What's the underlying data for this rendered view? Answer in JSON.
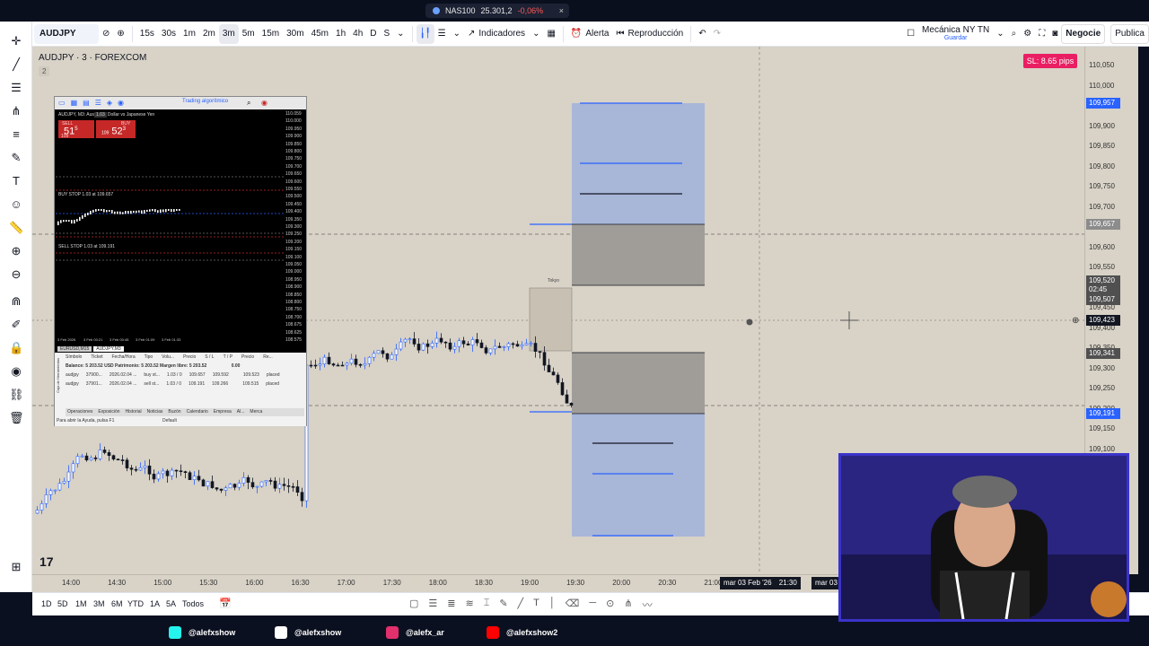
{
  "topstrip": {
    "ticker": "NAS100",
    "price": "25.301,2",
    "change": "-0,06%",
    "close": "×"
  },
  "toolbar": {
    "symbol": "AUDJPY",
    "intervals": [
      "15s",
      "30s",
      "1m",
      "2m",
      "3m",
      "5m",
      "15m",
      "30m",
      "45m",
      "1h",
      "4h",
      "D",
      "S"
    ],
    "active_interval": "3m",
    "indicators_label": "Indicadores",
    "alert_label": "Alerta",
    "replay_label": "Reproducción",
    "layout_name": "Mecánica NY TN",
    "layout_saved": "Guardar",
    "trade_label": "Negocie",
    "publish_label": "Publica"
  },
  "chart": {
    "title": "AUDJPY · 3 · FOREXCOM",
    "sub": "2",
    "sl_badge": "SL: 8.65 pips",
    "price_labels": [
      "110,050",
      "110,000",
      "109,950",
      "109,900",
      "109,850",
      "109,800",
      "109,750",
      "109,700",
      "109,650",
      "109,600",
      "109,550",
      "109,500",
      "109,450",
      "109,400",
      "109,350",
      "109,300",
      "109,250",
      "109,200",
      "109,150",
      "109,100"
    ],
    "price_tags": [
      {
        "text": "109,957",
        "color": "#2962ff"
      },
      {
        "text": "109,657",
        "color": "#8c8c8c"
      },
      {
        "text": "109,520",
        "color": "#505050"
      },
      {
        "text": "02:45",
        "color": "#505050"
      },
      {
        "text": "109,507",
        "color": "#505050"
      },
      {
        "text": "109,423",
        "color": "#131722"
      },
      {
        "text": "109,341",
        "color": "#505050"
      },
      {
        "text": "109,191",
        "color": "#2962ff"
      }
    ],
    "time_labels": [
      "14:00",
      "14:30",
      "15:00",
      "15:30",
      "16:00",
      "16:30",
      "17:00",
      "17:30",
      "18:00",
      "18:30",
      "19:00",
      "19:30",
      "20:00",
      "20:30",
      "21:00",
      "21:30"
    ],
    "crosshair_date": "mar 03 Feb '26",
    "crosshair_time": "21:30",
    "right_date": "mar 03",
    "tokyo_label": "Tokyo",
    "tv_logo": "17"
  },
  "bottombar": {
    "ranges": [
      "1D",
      "5D",
      "1M",
      "3M",
      "6M",
      "YTD",
      "1A",
      "5A",
      "Todos"
    ]
  },
  "social": [
    {
      "handle": "@alefxshow",
      "icon": "tiktok-icon",
      "color": "#25f4ee"
    },
    {
      "handle": "@alefxshow",
      "icon": "x-icon",
      "color": "#ffffff"
    },
    {
      "handle": "@alefx_ar",
      "icon": "instagram-icon",
      "color": "#e1306c"
    },
    {
      "handle": "@alefxshow2",
      "icon": "youtube-icon",
      "color": "#ff0000"
    }
  ],
  "mt5": {
    "algo_label": "Trading algorítmico",
    "symbol_line": "AUDJPY, M3: Australian Dollar vs Japanese Yen",
    "sell_label": "SELL",
    "buy_label": "BUY",
    "lot": "1.03",
    "sell_price_prefix": "109",
    "sell_price_main": "51",
    "sell_price_sup": "5",
    "buy_price_prefix": "109",
    "buy_price_main": "52",
    "buy_price_sup": "3",
    "buy_stop_label": "BUY STOP 1.03 at 109.657",
    "sell_stop_label": "SELL STOP 1.03 at 109.191",
    "price_labels": [
      "110.059",
      "110.000",
      "109.950",
      "109.900",
      "109.850",
      "109.800",
      "109.750",
      "109.700",
      "109.650",
      "109.600",
      "109.550",
      "109.500",
      "109.450",
      "109.400",
      "109.350",
      "109.300",
      "109.250",
      "109.200",
      "109.150",
      "109.100",
      "109.050",
      "109.000",
      "108.950",
      "108.900",
      "108.850",
      "108.800",
      "108.750",
      "108.700",
      "108.675",
      "108.625",
      "108.575"
    ],
    "date_labels": [
      "3 Feb 2026",
      "3 Feb 00:21",
      "3 Feb 00:45",
      "3 Feb 01:09",
      "3 Feb 01:33"
    ],
    "chart_tabs": [
      "EURUSD,M15",
      "AUDJPY,M3"
    ],
    "table_headers": [
      "Símbolo",
      "Ticket",
      "Fecha/Hora",
      "Tipo",
      "Volu...",
      "Precio",
      "S / L",
      "T / P",
      "Precio",
      "Re..."
    ],
    "balance_line": "Balance: 5 203.52 USD  Patrimonio: 5 203.52  Margen libre: 5 203.52",
    "balance_value": "0.00",
    "rows": [
      {
        "symbol": "audjpy",
        "ticket": "37900...",
        "time": "2026.02.04 ...",
        "type": "buy st...",
        "volume": "1.03 / 0",
        "price": "109.657",
        "sl": "109.592",
        "tp": "",
        "current": "109.523",
        "state": "placed"
      },
      {
        "symbol": "audjpy",
        "ticket": "37901...",
        "time": "2026.02.04 ...",
        "type": "sell st...",
        "volume": "1.03 / 0",
        "price": "109.191",
        "sl": "109.266",
        "tp": "",
        "current": "109.515",
        "state": "placed"
      }
    ],
    "bottom_tabs": [
      "Operaciones",
      "Exposición",
      "Historial",
      "Noticias",
      "Buzón",
      "Calendario",
      "Empresa",
      "Al...",
      "Merca"
    ],
    "help_text": "Para abrir la Ayuda, pulsa F1",
    "profile": "Default",
    "side_tab": "Caja de Herramientas"
  }
}
